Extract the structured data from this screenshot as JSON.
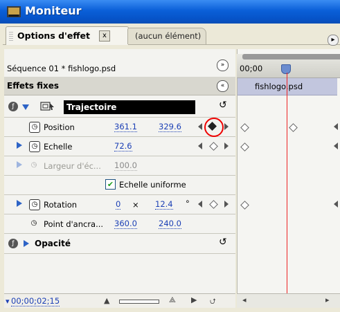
{
  "window": {
    "title": "Moniteur"
  },
  "tabs": {
    "active_label": "Options d'effet",
    "close_glyph": "x",
    "inactive_label": "(aucun élément)"
  },
  "sequence": {
    "label": "Séquence 01 * fishlogo.psd"
  },
  "fixed_effects": {
    "header": "Effets fixes",
    "trajectory_label": "Trajectoire",
    "position": {
      "label": "Position",
      "x": "361.1",
      "y": "329.6"
    },
    "scale": {
      "label": "Echelle",
      "value": "72.6"
    },
    "scale_width": {
      "label": "Largeur d'éc...",
      "value": "100.0"
    },
    "uniform_scale": {
      "label": "Echelle uniforme",
      "checked": true
    },
    "rotation": {
      "label": "Rotation",
      "turns": "0",
      "times": "×",
      "degrees": "12.4",
      "degree_sign": "°"
    },
    "anchor": {
      "label": "Point d'ancra...",
      "x": "360.0",
      "y": "240.0"
    },
    "opacity_label": "Opacité"
  },
  "timeline": {
    "timecode": "00;00",
    "clip_name": "fishlogo.psd"
  },
  "footer": {
    "current_time": "00;00;02;15"
  },
  "colors": {
    "titlebar": "#0653c8",
    "value_blue": "#1b3fb5",
    "playhead": "#e22222",
    "highlight_circle": "#e00000",
    "clip_bar": "#c2c6de"
  }
}
